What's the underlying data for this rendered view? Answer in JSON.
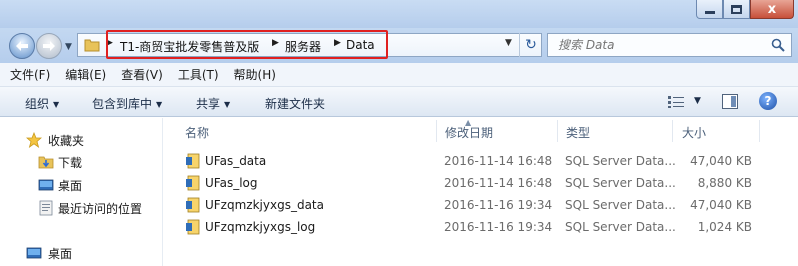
{
  "window": {
    "minimize_glyph": "",
    "close_glyph": "x"
  },
  "address": {
    "breadcrumbs": [
      "T1-商贸宝批发零售普及版",
      "服务器",
      "Data"
    ],
    "refresh_glyph": "↻"
  },
  "search": {
    "placeholder": "搜索 Data"
  },
  "menu": {
    "items": [
      "文件(F)",
      "编辑(E)",
      "查看(V)",
      "工具(T)",
      "帮助(H)"
    ]
  },
  "toolbar": {
    "organize": "组织",
    "include_in_library": "包含到库中",
    "share": "共享",
    "new_folder": "新建文件夹",
    "help_glyph": "?"
  },
  "sidebar": {
    "items": [
      {
        "label": "收藏夹",
        "icon": "star-icon"
      },
      {
        "label": "下载",
        "icon": "download-folder-icon"
      },
      {
        "label": "桌面",
        "icon": "desktop-icon"
      },
      {
        "label": "最近访问的位置",
        "icon": "recent-places-icon"
      },
      {
        "label": "桌面",
        "icon": "desktop-icon"
      }
    ]
  },
  "columns": {
    "name": "名称",
    "modified": "修改日期",
    "type": "类型",
    "size": "大小"
  },
  "files": [
    {
      "name": "UFas_data",
      "modified": "2016-11-14 16:48",
      "type": "SQL Server Data...",
      "size": "47,040 KB"
    },
    {
      "name": "UFas_log",
      "modified": "2016-11-14 16:48",
      "type": "SQL Server Data...",
      "size": "8,880 KB"
    },
    {
      "name": "UFzqmzkjyxgs_data",
      "modified": "2016-11-16 19:34",
      "type": "SQL Server Data...",
      "size": "47,040 KB"
    },
    {
      "name": "UFzqmzkjyxgs_log",
      "modified": "2016-11-16 19:34",
      "type": "SQL Server Data...",
      "size": "1,024 KB"
    }
  ],
  "colors": {
    "highlight_border": "#e02020",
    "titlebar": "#c9dcf3",
    "close_button": "#c7503a"
  }
}
